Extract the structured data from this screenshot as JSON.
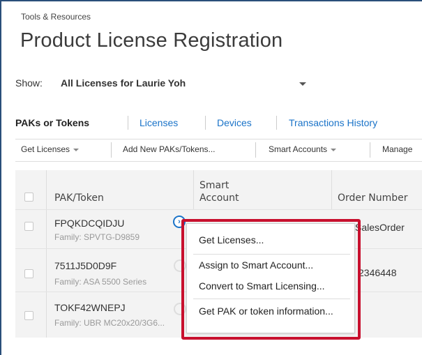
{
  "breadcrumb": "Tools & Resources",
  "page_title": "Product License Registration",
  "show": {
    "label": "Show:",
    "value": "All Licenses for Laurie Yoh"
  },
  "tabs": [
    {
      "label": "PAKs or Tokens",
      "active": true
    },
    {
      "label": "Licenses"
    },
    {
      "label": "Devices"
    },
    {
      "label": "Transactions History"
    }
  ],
  "toolbar": {
    "get_licenses": "Get Licenses",
    "add_new": "Add New PAKs/Tokens...",
    "smart_accounts": "Smart Accounts",
    "manage": "Manage"
  },
  "table": {
    "headers": {
      "pak": "PAK/Token",
      "smart_account_1": "Smart",
      "smart_account_2": "Account",
      "order": "Order Number"
    },
    "rows": [
      {
        "pak": "FPQKDCQIDJU",
        "family": "Family: SPVTG-D9859",
        "order": "SalesOrder"
      },
      {
        "pak": "7511J5D0D9F",
        "family": "Family: ASA 5500 Series",
        "order": "2346448"
      },
      {
        "pak": "TOKF42WNEPJ",
        "family": "Family: UBR MC20x20/3G6..."
      }
    ]
  },
  "context_menu": {
    "items": [
      "Get Licenses...",
      "Assign to Smart Account...",
      "Convert to Smart Licensing...",
      "Get PAK or token information..."
    ]
  },
  "icons": {
    "info": "chevron-right-circle-icon"
  },
  "colors": {
    "link": "#1a73c8",
    "highlight": "#c8102e"
  }
}
